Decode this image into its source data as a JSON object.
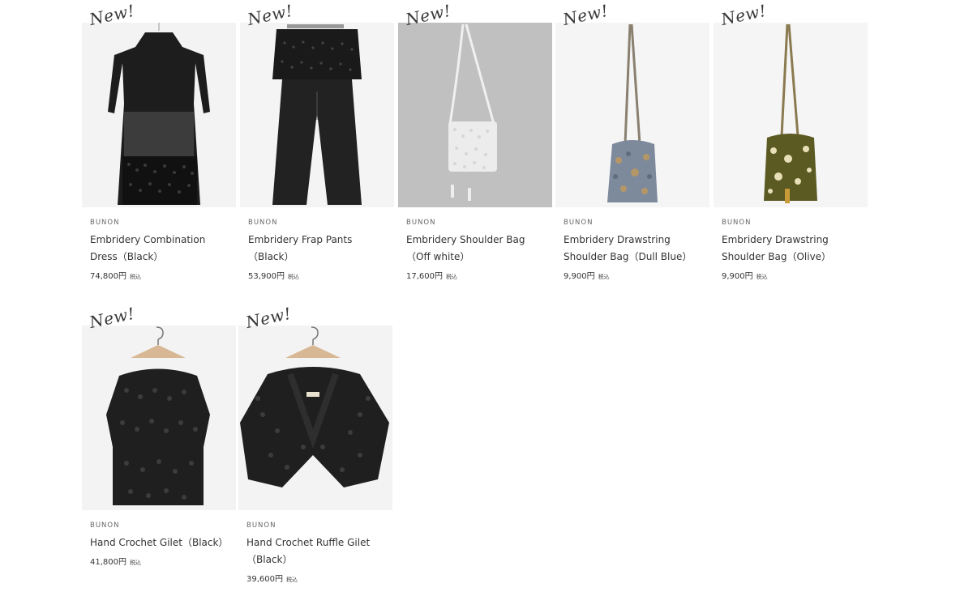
{
  "badge_text": "New!",
  "products": [
    {
      "brand": "BUNON",
      "name": "Embridery Combination Dress（Black）",
      "price": "74,800円",
      "tax": "税込",
      "image_icon": "black-dress-photo"
    },
    {
      "brand": "BUNON",
      "name": "Embridery Frap Pants（Black）",
      "price": "53,900円",
      "tax": "税込",
      "image_icon": "black-pants-photo"
    },
    {
      "brand": "BUNON",
      "name": "Embridery Shoulder Bag（Off white）",
      "price": "17,600円",
      "tax": "税込",
      "image_icon": "white-shoulder-bag-photo"
    },
    {
      "brand": "BUNON",
      "name": "Embridery Drawstring Shoulder Bag（Dull Blue）",
      "price": "9,900円",
      "tax": "税込",
      "image_icon": "blue-drawstring-bag-photo"
    },
    {
      "brand": "BUNON",
      "name": "Embridery Drawstring Shoulder Bag（Olive）",
      "price": "9,900円",
      "tax": "税込",
      "image_icon": "olive-drawstring-bag-photo"
    },
    {
      "brand": "BUNON",
      "name": "Hand Crochet Gilet（Black）",
      "price": "41,800円",
      "tax": "税込",
      "image_icon": "black-crochet-gilet-photo"
    },
    {
      "brand": "BUNON",
      "name": "Hand Crochet Ruffle Gilet（Black）",
      "price": "39,600円",
      "tax": "税込",
      "image_icon": "black-ruffle-gilet-photo"
    }
  ]
}
